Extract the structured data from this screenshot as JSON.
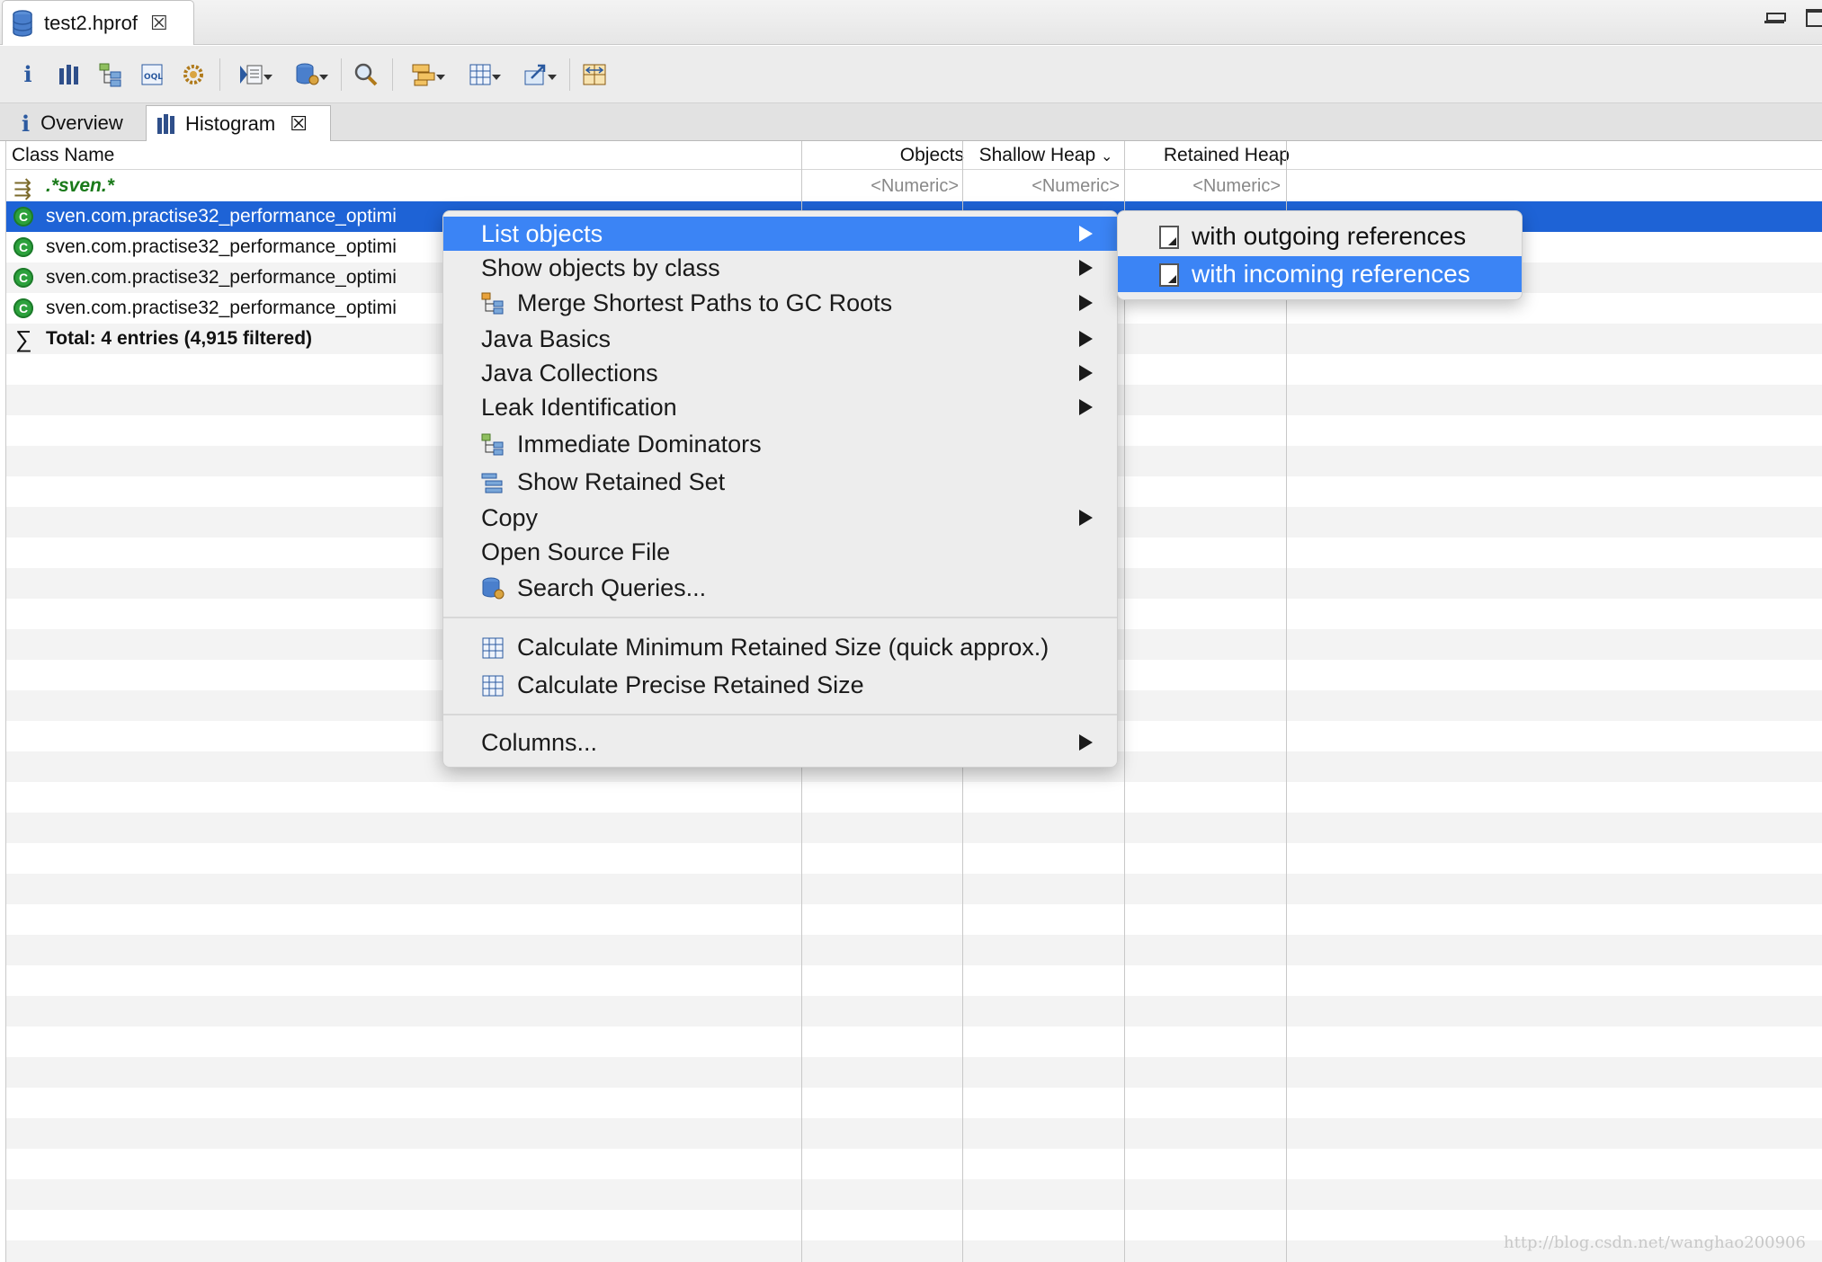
{
  "editor_tab": {
    "title": "test2.hprof"
  },
  "view_tabs": [
    {
      "label": "Overview"
    },
    {
      "label": "Histogram"
    }
  ],
  "table": {
    "columns": {
      "class_name": "Class Name",
      "objects": "Objects",
      "shallow_heap": "Shallow Heap",
      "retained_heap": "Retained Heap"
    },
    "filter_row": {
      "class_filter": ".*sven.*",
      "objects_placeholder": "<Numeric>",
      "shallow_placeholder": "<Numeric>",
      "retained_placeholder": "<Numeric>"
    },
    "rows": [
      {
        "name": "sven.com.practise32_performance_optimi"
      },
      {
        "name": "sven.com.practise32_performance_optimi"
      },
      {
        "name": "sven.com.practise32_performance_optimi"
      },
      {
        "name": "sven.com.practise32_performance_optimi"
      }
    ],
    "total": "Total: 4 entries (4,915 filtered)"
  },
  "context_menu": {
    "list_objects": "List objects",
    "show_objects_by_class": "Show objects by class",
    "merge_shortest_paths": "Merge Shortest Paths to GC Roots",
    "java_basics": "Java Basics",
    "java_collections": "Java Collections",
    "leak_identification": "Leak Identification",
    "immediate_dominators": "Immediate Dominators",
    "show_retained_set": "Show Retained Set",
    "copy": "Copy",
    "open_source_file": "Open Source File",
    "search_queries": "Search Queries...",
    "calc_min_retained": "Calculate Minimum Retained Size (quick approx.)",
    "calc_precise_retained": "Calculate Precise Retained Size",
    "columns": "Columns..."
  },
  "submenu": {
    "outgoing": "with outgoing references",
    "incoming": "with incoming references"
  },
  "watermark": "http://blog.csdn.net/wanghao200906",
  "colors": {
    "selection": "#1e63d6",
    "menu_highlight": "#3b84f5",
    "class_icon": "#2ca13c"
  }
}
